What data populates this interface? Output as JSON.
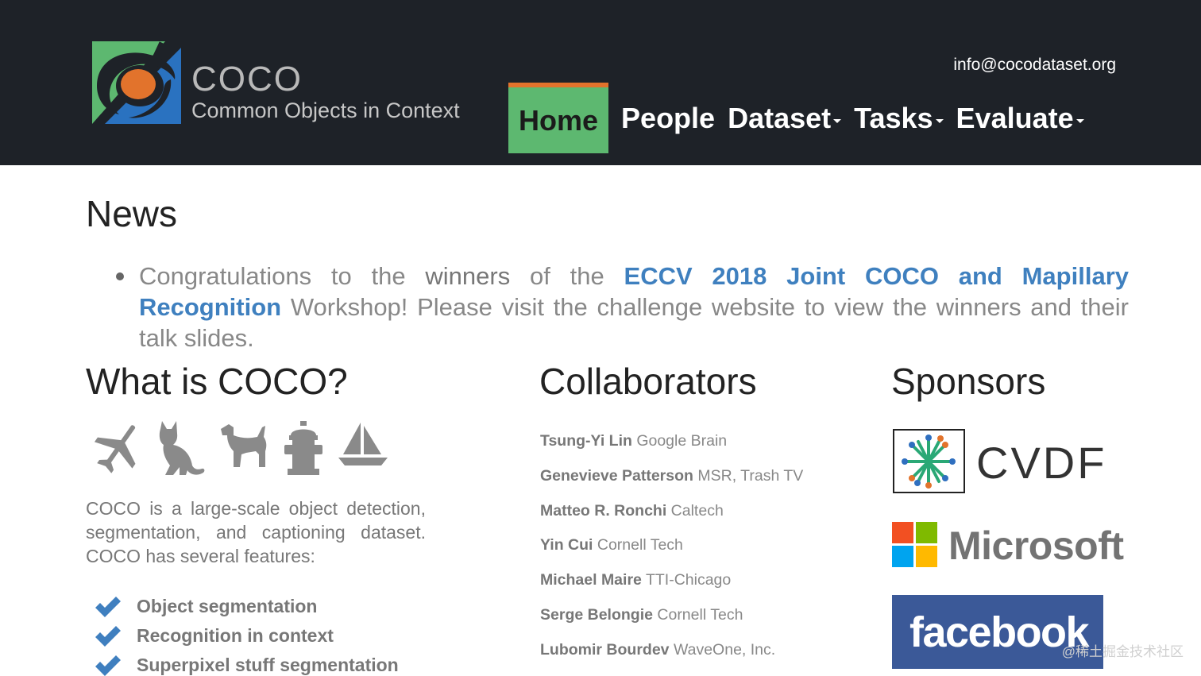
{
  "header": {
    "logo_title": "COCO",
    "logo_subtitle": "Common Objects in Context",
    "email": "info@cocodataset.org",
    "nav": [
      {
        "label": "Home",
        "active": true
      },
      {
        "label": "People"
      },
      {
        "label": "Dataset",
        "dropdown": true
      },
      {
        "label": "Tasks",
        "dropdown": true
      },
      {
        "label": "Evaluate",
        "dropdown": true
      }
    ],
    "colors": {
      "navbar_bg": "#1e2228",
      "active_bg": "#5db870",
      "active_border": "#e2732c"
    }
  },
  "news": {
    "heading": "News",
    "item": {
      "prefix": "Congratulations to the",
      "winners": "winners",
      "middle": "of the",
      "link": "ECCV 2018 Joint COCO and Mapillary Recognition",
      "suffix": "Workshop! Please visit the challenge website to view the winners and their talk slides."
    }
  },
  "what_is_coco": {
    "heading": "What is COCO?",
    "icons": [
      "airplane-icon",
      "cat-icon",
      "dog-icon",
      "fire-hydrant-icon",
      "sailboat-icon"
    ],
    "description": "COCO is a large-scale object detection, segmentation, and captioning dataset. COCO has several features:",
    "features": [
      "Object segmentation",
      "Recognition in context",
      "Superpixel stuff segmentation"
    ]
  },
  "collaborators": {
    "heading": "Collaborators",
    "people": [
      {
        "name": "Tsung-Yi Lin",
        "affiliation": "Google Brain"
      },
      {
        "name": "Genevieve Patterson",
        "affiliation": "MSR, Trash TV"
      },
      {
        "name": "Matteo R. Ronchi",
        "affiliation": "Caltech"
      },
      {
        "name": "Yin Cui",
        "affiliation": "Cornell Tech"
      },
      {
        "name": "Michael Maire",
        "affiliation": "TTI-Chicago"
      },
      {
        "name": "Serge Belongie",
        "affiliation": "Cornell Tech"
      },
      {
        "name": "Lubomir Bourdev",
        "affiliation": "WaveOne, Inc."
      }
    ]
  },
  "sponsors": {
    "heading": "Sponsors",
    "items": [
      "CVDF",
      "Microsoft",
      "facebook"
    ]
  },
  "watermark": "@稀土掘金技术社区"
}
